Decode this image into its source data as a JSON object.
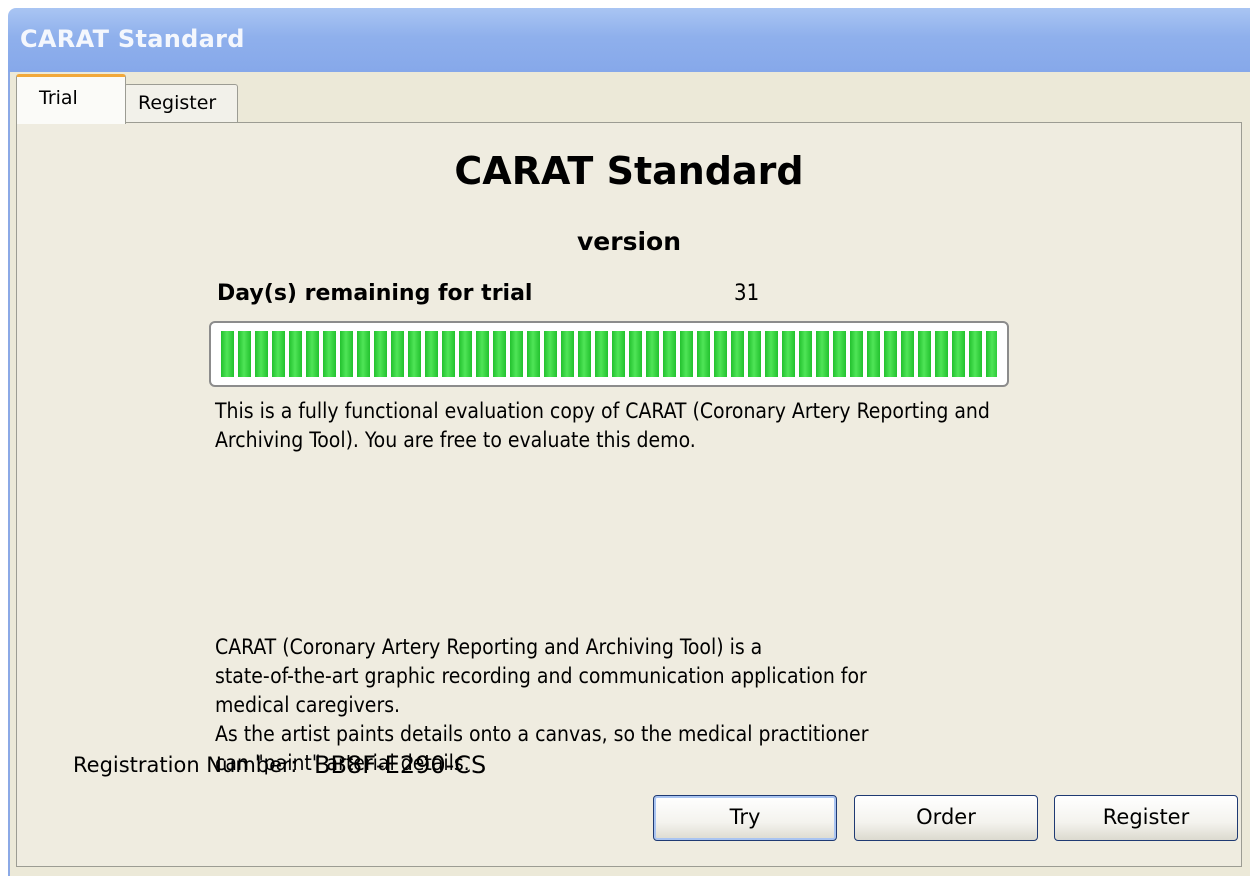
{
  "window": {
    "title": "CARAT Standard"
  },
  "tabs": [
    {
      "label": "Trial",
      "active": true
    },
    {
      "label": "Register",
      "active": false
    }
  ],
  "trial": {
    "product_name": "CARAT Standard",
    "version_label": "version",
    "days_label": "Day(s) remaining for trial",
    "days_remaining": "31",
    "progress_fraction": 1.0,
    "progress_color": "#22c12e",
    "description_1": "This is a fully functional evaluation copy of CARAT (Coronary Artery Reporting and Archiving Tool). You are free to evaluate this demo.",
    "description_2_lines": [
      "CARAT (Coronary Artery Reporting and Archiving Tool) is a",
      "state-of-the-art graphic recording and communication application for",
      "medical caregivers.",
      "As the artist paints details onto a canvas, so the medical practitioner",
      "can \"paint\" arterial details."
    ],
    "registration_label": "Registration Number:",
    "registration_number": "BB8F-E290-CS"
  },
  "buttons": {
    "try": "Try",
    "order": "Order",
    "register": "Register"
  }
}
